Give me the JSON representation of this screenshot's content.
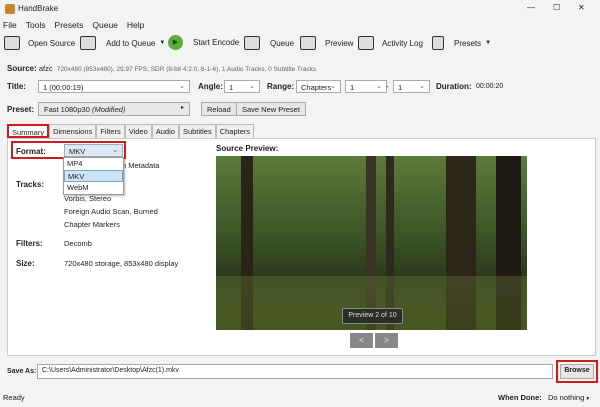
{
  "window": {
    "title": "HandBrake",
    "minimize": "—",
    "maximize": "☐",
    "close": "✕"
  },
  "menu": [
    "File",
    "Tools",
    "Presets",
    "Queue",
    "Help"
  ],
  "toolbar": {
    "open_source": "Open Source",
    "add_to_queue": "Add to Queue",
    "start_encode": "Start Encode",
    "queue": "Queue",
    "preview": "Preview",
    "activity_log": "Activity Log",
    "presets": "Presets"
  },
  "source": {
    "label": "Source:",
    "name": "afzc",
    "info": "720x480 (853x480), 29.97 FPS, SDR (8-bit 4:2:0, 6-1-6), 1 Audio Tracks, 0 Subtitle Tracks"
  },
  "title_row": {
    "title_label": "Title:",
    "title_value": "1 (00:00:19)",
    "angle_label": "Angle:",
    "angle_value": "1",
    "range_label": "Range:",
    "range_value": "Chapters",
    "range_from": "1",
    "dash": "-",
    "range_to": "1",
    "duration_label": "Duration:",
    "duration_value": "00:00:20"
  },
  "preset": {
    "label": "Preset:",
    "value": "Fast 1080p30",
    "modified": "(Modified)",
    "reload": "Reload",
    "save_new": "Save New Preset"
  },
  "tabs": [
    "Summary",
    "Dimensions",
    "Filters",
    "Video",
    "Audio",
    "Subtitles",
    "Chapters"
  ],
  "summary": {
    "format_label": "Format:",
    "format_value": "MKV",
    "format_options": [
      "MP4",
      "MKV",
      "WebM"
    ],
    "metadata": "Passthru Common Metadata",
    "tracks_label": "Tracks:",
    "tracks": [
      "Vorbis, Stereo",
      "Foreign Audio Scan, Burned",
      "Chapter Markers"
    ],
    "filters_label": "Filters:",
    "filters": "Decomb",
    "size_label": "Size:",
    "size": "720x480 storage, 853x480 display"
  },
  "preview": {
    "label": "Source Preview:",
    "counter": "Preview 2 of 10",
    "prev": "<",
    "next": ">"
  },
  "save_as": {
    "label": "Save As:",
    "path": "C:\\Users\\Administrator\\Desktop\\Afzc(1).mkv",
    "browse": "Browse"
  },
  "status": {
    "text": "Ready",
    "when_done_label": "When Done:",
    "when_done_value": "Do nothing"
  }
}
